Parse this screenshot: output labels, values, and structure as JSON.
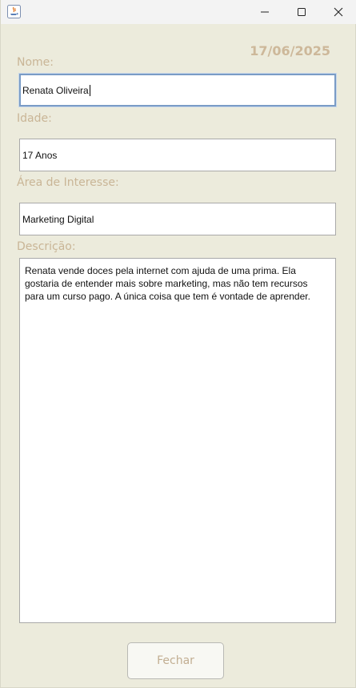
{
  "form": {
    "date": "17/06/2025",
    "name_label": "Nome:",
    "name_value": "Renata Oliveira",
    "age_label": "Idade:",
    "age_value": "17 Anos",
    "interest_label": "Área de Interesse:",
    "interest_value": "Marketing Digital",
    "description_label": "Descrição:",
    "description_value": "Renata vende doces pela internet com ajuda de uma prima. Ela gostaria de entender mais sobre marketing, mas não tem recursos para um curso pago. A única coisa que tem é vontade de aprender.",
    "close_label": "Fechar"
  },
  "colors": {
    "background": "#ecebdc",
    "label": "#c9b596",
    "focus_border": "#7a9cc6"
  },
  "icons": {
    "app": "java-icon",
    "minimize": "minimize-icon",
    "maximize": "maximize-icon",
    "close": "close-icon"
  }
}
